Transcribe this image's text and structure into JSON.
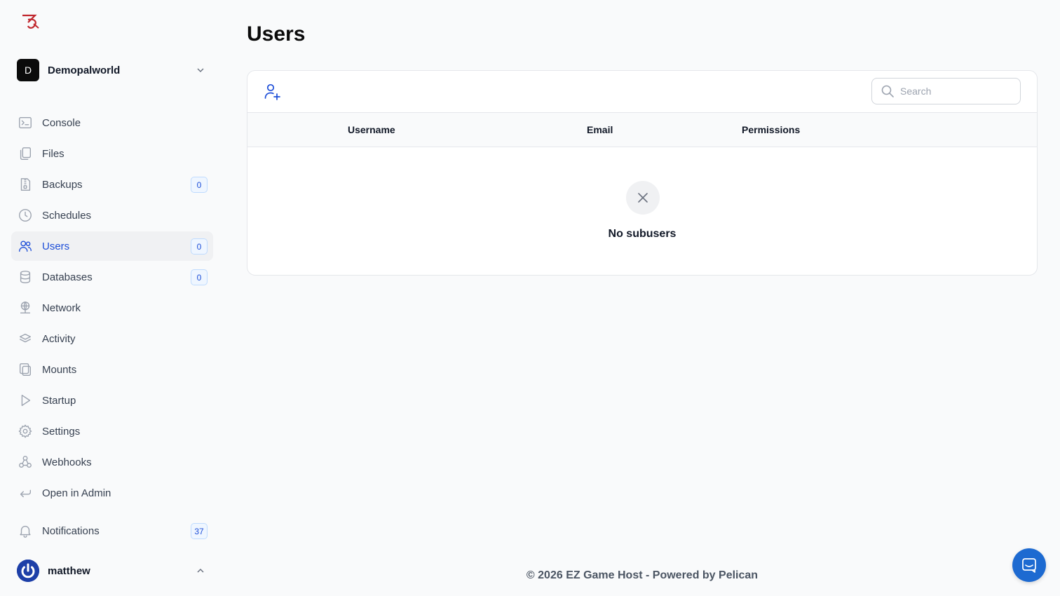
{
  "tenant": {
    "initial": "D",
    "name": "Demopalworld"
  },
  "nav": [
    {
      "key": "console",
      "label": "Console",
      "icon": "terminal-icon"
    },
    {
      "key": "files",
      "label": "Files",
      "icon": "files-icon"
    },
    {
      "key": "backups",
      "label": "Backups",
      "icon": "zip-icon",
      "badge": "0"
    },
    {
      "key": "schedules",
      "label": "Schedules",
      "icon": "clock-icon"
    },
    {
      "key": "users",
      "label": "Users",
      "icon": "users-icon",
      "badge": "0",
      "active": true
    },
    {
      "key": "databases",
      "label": "Databases",
      "icon": "database-icon",
      "badge": "0"
    },
    {
      "key": "network",
      "label": "Network",
      "icon": "network-icon"
    },
    {
      "key": "activity",
      "label": "Activity",
      "icon": "stack-icon"
    },
    {
      "key": "mounts",
      "label": "Mounts",
      "icon": "mounts-icon"
    },
    {
      "key": "startup",
      "label": "Startup",
      "icon": "play-icon"
    },
    {
      "key": "settings",
      "label": "Settings",
      "icon": "gear-icon"
    },
    {
      "key": "webhooks",
      "label": "Webhooks",
      "icon": "webhook-icon"
    },
    {
      "key": "admin",
      "label": "Open in Admin",
      "icon": "return-arrow-icon"
    }
  ],
  "notifications": {
    "label": "Notifications",
    "count": "37"
  },
  "user": {
    "name": "matthew"
  },
  "page": {
    "title": "Users"
  },
  "search": {
    "placeholder": "Search",
    "value": ""
  },
  "table": {
    "columns": [
      "Username",
      "Email",
      "Permissions"
    ],
    "empty_text": "No subusers"
  },
  "footer": {
    "text": "© 2026 EZ Game Host - Powered by Pelican"
  },
  "colors": {
    "accent": "#1d4ed8",
    "chat": "#1d6ad1"
  }
}
